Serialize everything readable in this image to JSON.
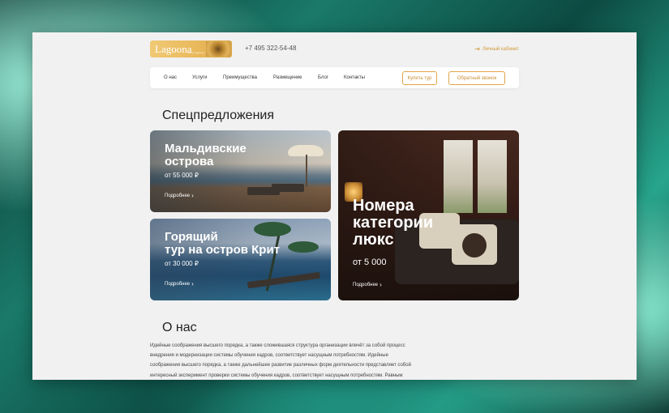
{
  "header": {
    "logo_text": "Lagoona",
    "logo_subtitle": "travel agency",
    "phone": "+7 495 322-54-48",
    "cabinet_label": "Личный кабинет"
  },
  "nav": {
    "items": [
      "О нас",
      "Услуги",
      "Преимущества",
      "Размещение",
      "Блог",
      "Контакты"
    ],
    "buy_tour_label": "Купить тур",
    "callback_label": "Обратный звонок"
  },
  "offers": {
    "title": "Спецпредложения",
    "cards": [
      {
        "title_line1": "Мальдивские",
        "title_line2": "острова",
        "price": "от 55 000 ₽",
        "more": "Подробнее"
      },
      {
        "title_line1": "Горящий",
        "title_line2": "тур на остров Крит",
        "price": "от 30 000 ₽",
        "more": "Подробнее"
      },
      {
        "title_line1": "Номера",
        "title_line2": "категории",
        "title_line3": "люкс",
        "price": "от 5 000",
        "more": "Подробнее"
      }
    ]
  },
  "about": {
    "title": "О нас",
    "lines": [
      "Идейные соображения высшего порядка, а также сложившаяся структура организации влечёт за собой процесс",
      "внедрения и модернизации системы обучения кадров, соответствует насущным потребностям. Идейные",
      "соображения высшего порядка, а также дальнейшее развитие различных форм деятельности представляет собой",
      "интересный эксперимент проверки системы обучения кадров, соответствует насущным потребностям. Равным"
    ]
  },
  "colors": {
    "accent": "#e2a54a",
    "background": "#f1f1f1"
  }
}
